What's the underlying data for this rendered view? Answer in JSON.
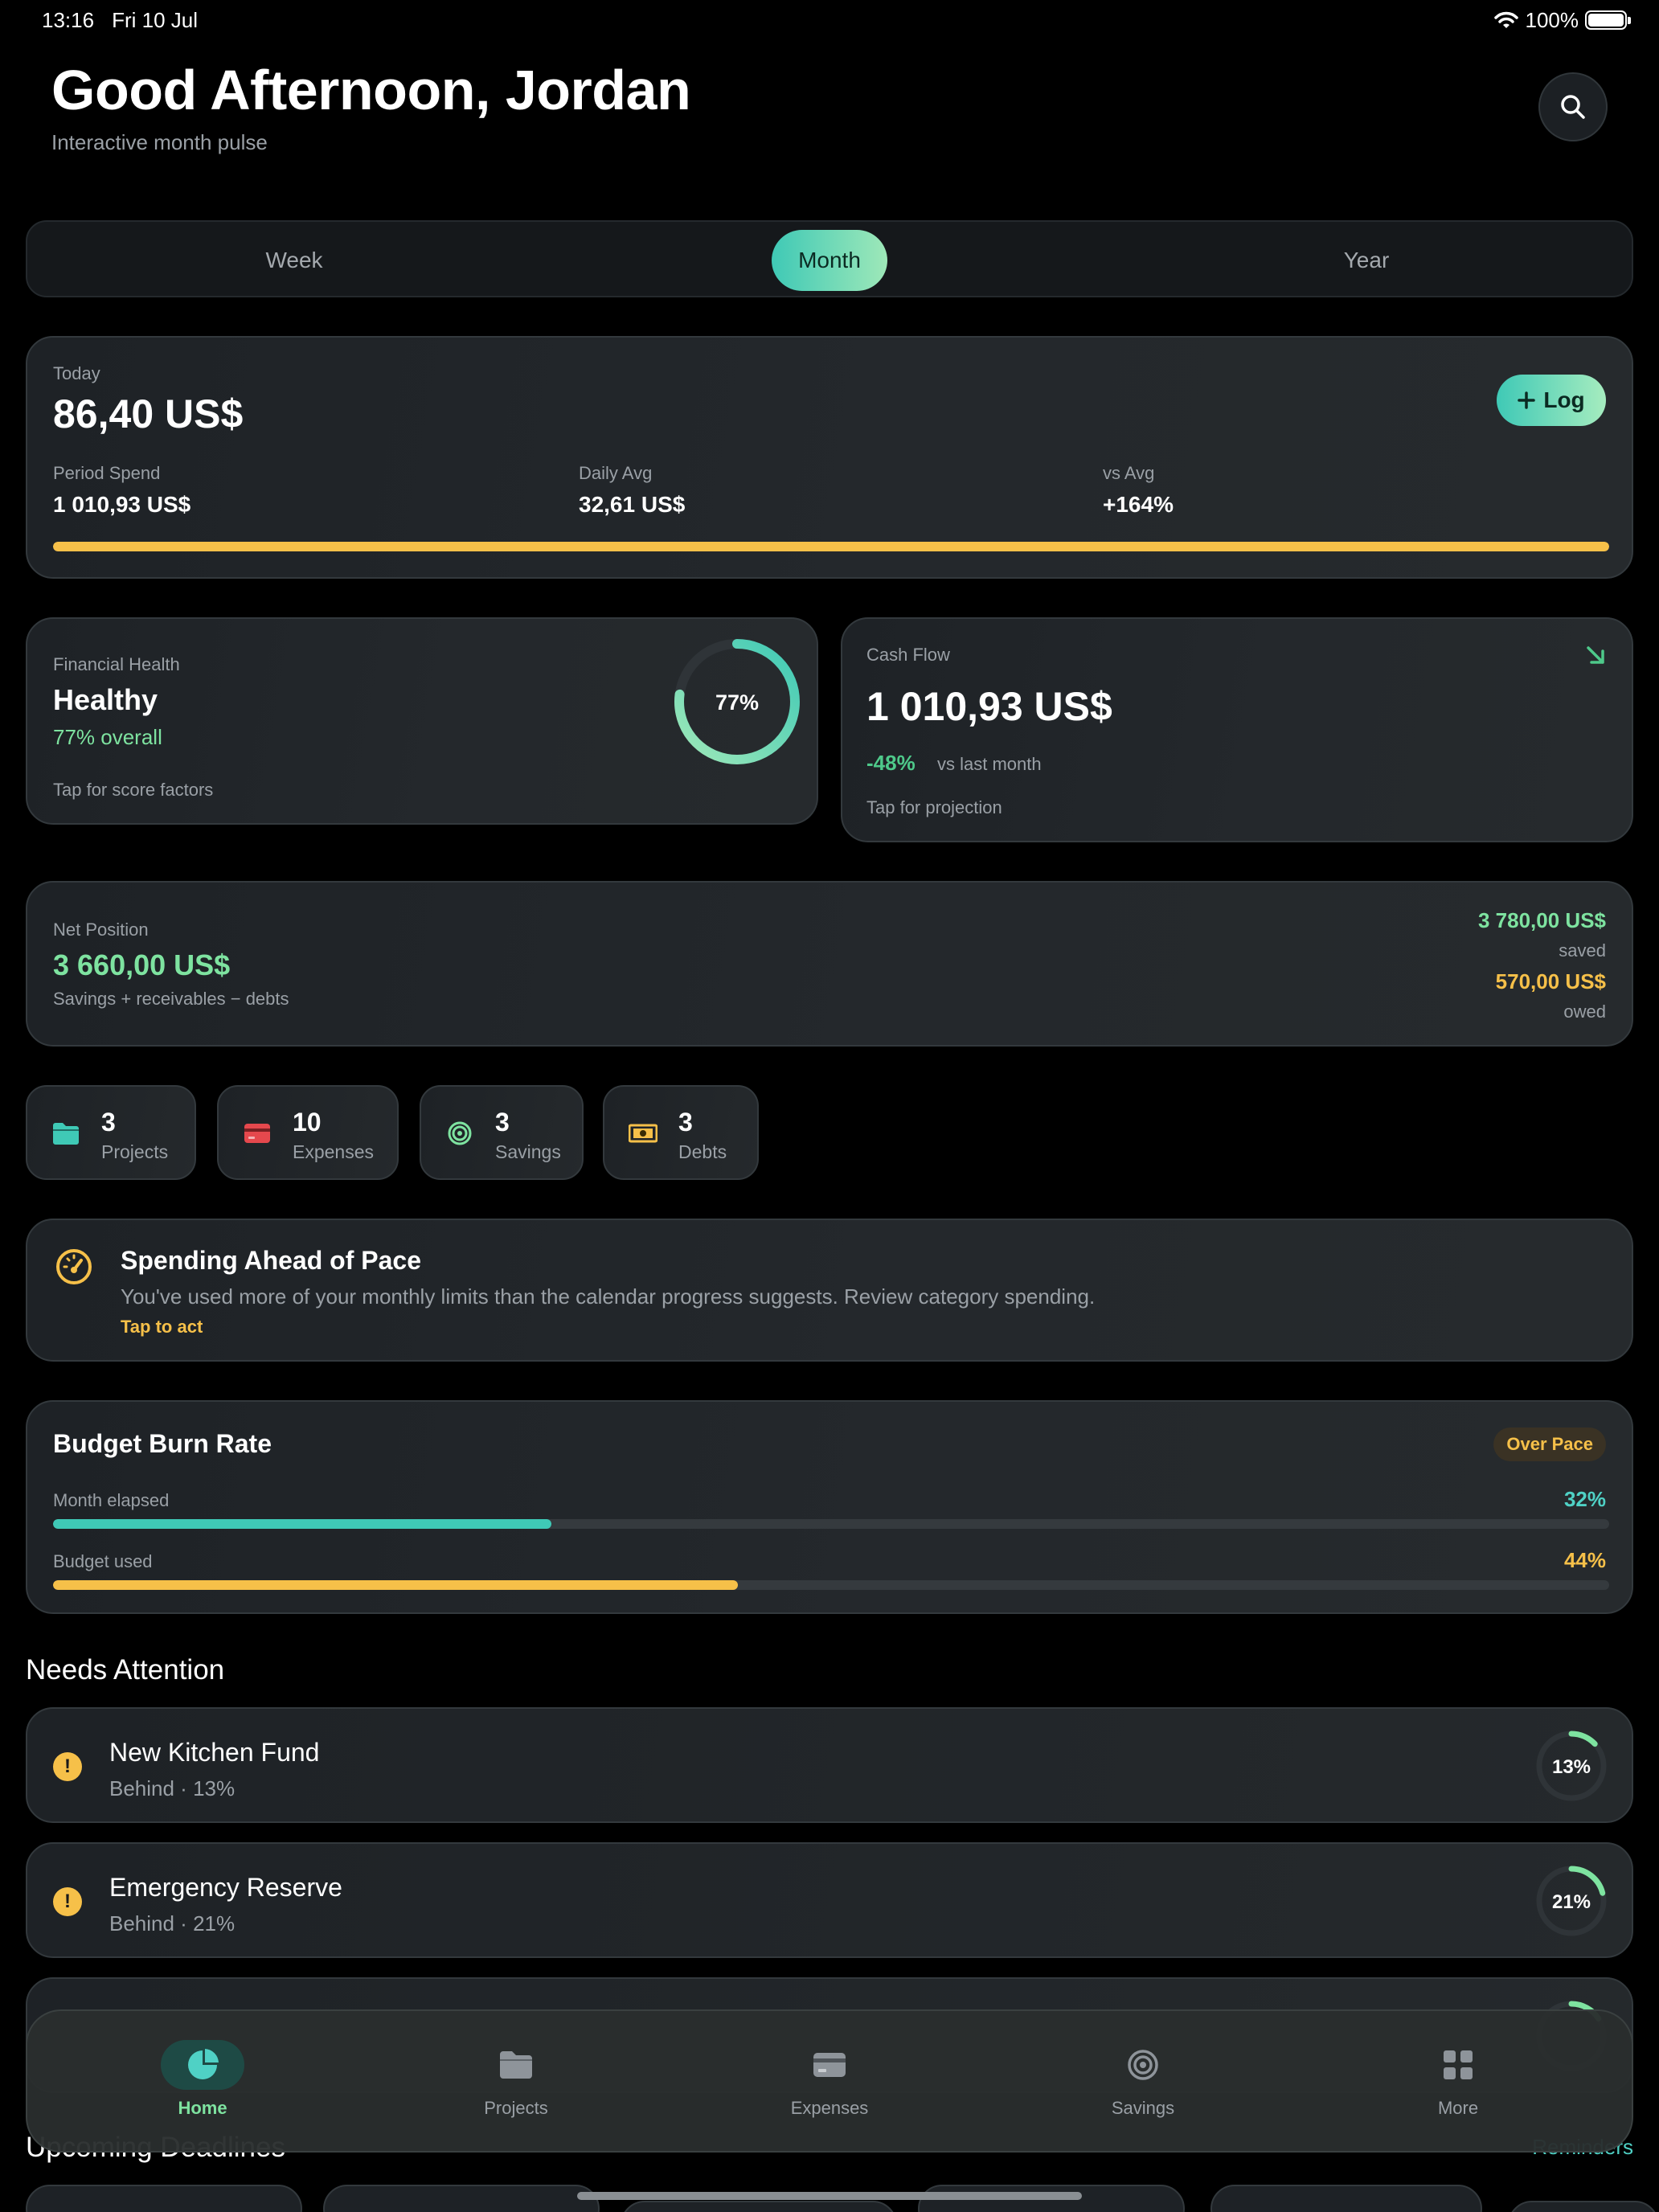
{
  "status_bar": {
    "time": "13:16",
    "date": "Fri 10 Jul",
    "battery": "100%"
  },
  "header": {
    "greeting": "Good Afternoon, Jordan",
    "subtitle": "Interactive month pulse"
  },
  "period_tabs": {
    "items": [
      "Week",
      "Month",
      "Year"
    ],
    "selected": "Month"
  },
  "today_card": {
    "label": "Today",
    "amount": "86,40 US$",
    "log_label": "Log",
    "stats": [
      {
        "label": "Period Spend",
        "value": "1 010,93 US$"
      },
      {
        "label": "Daily Avg",
        "value": "32,61 US$"
      },
      {
        "label": "vs Avg",
        "value": "+164%"
      }
    ],
    "progress_fraction": 1.0
  },
  "health_card": {
    "label": "Financial Health",
    "status": "Healthy",
    "overall": "77% overall",
    "hint": "Tap for score factors",
    "ring_text": "77%",
    "score_fraction": 0.77
  },
  "cashflow_card": {
    "label": "Cash Flow",
    "amount": "1 010,93 US$",
    "change": "-48%",
    "change_label": "vs last month",
    "hint": "Tap for projection"
  },
  "net_position": {
    "label": "Net Position",
    "amount": "3 660,00 US$",
    "subtitle": "Savings + receivables − debts",
    "saved_amount": "3 780,00 US$",
    "saved_label": "saved",
    "owed_amount": "570,00 US$",
    "owed_label": "owed"
  },
  "stat_chips": [
    {
      "count": "3",
      "label": "Projects",
      "icon": "folder-icon"
    },
    {
      "count": "10",
      "label": "Expenses",
      "icon": "credit-card-icon"
    },
    {
      "count": "3",
      "label": "Savings",
      "icon": "target-icon"
    },
    {
      "count": "3",
      "label": "Debts",
      "icon": "banknote-icon"
    }
  ],
  "alert": {
    "title": "Spending Ahead of Pace",
    "message": "You've used more of your monthly limits than the calendar progress suggests. Review category spending.",
    "action": "Tap to act"
  },
  "burn_rate": {
    "title": "Budget Burn Rate",
    "badge": "Over Pace",
    "month_label": "Month elapsed",
    "month_value": "32%",
    "month_fraction": 0.32,
    "budget_label": "Budget used",
    "budget_value": "44%",
    "budget_fraction": 0.44
  },
  "needs_attention": {
    "title": "Needs Attention",
    "items": [
      {
        "name": "New Kitchen Fund",
        "status": "Behind · 13%",
        "ring": "13%",
        "fraction": 0.13
      },
      {
        "name": "Emergency Reserve",
        "status": "Behind · 21%",
        "ring": "21%",
        "fraction": 0.21
      }
    ]
  },
  "upcoming": {
    "title": "Upcoming Deadlines",
    "link": "Reminders"
  },
  "tab_bar": {
    "items": [
      "Home",
      "Projects",
      "Expenses",
      "Savings",
      "More"
    ],
    "active": "Home"
  },
  "colors": {
    "accent_teal": "#4fd1c5",
    "accent_green": "#7ee3a0",
    "warning": "#f6c049",
    "danger": "#e5484d",
    "background": "#000000"
  }
}
